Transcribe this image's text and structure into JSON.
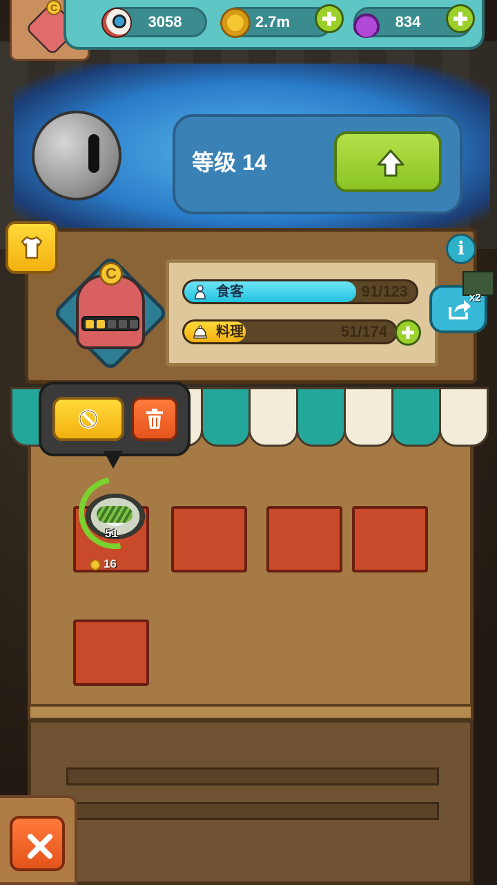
{
  "resources": {
    "eyeballs": "3058",
    "coins": "2.7m",
    "potions": "834"
  },
  "level": {
    "label": "等级 14"
  },
  "stats": {
    "guests_label": "食客",
    "guests_value": "91/123",
    "guests_fill": 0.74,
    "dishes_label": "料理",
    "dishes_value": "51/174",
    "dishes_fill": 0.29
  },
  "share": {
    "multiplier": "x2"
  },
  "dish_slot": {
    "count": "51",
    "price": "16",
    "progress": 0.75
  },
  "colors": {
    "accent_green": "#9bd02a",
    "accent_yellow": "#f2b10f",
    "accent_orange": "#e4541c",
    "guests_bar": "#22c2df",
    "awning_teal": "#23a79b"
  },
  "icons": {
    "eyeball": "eyeball-icon",
    "coin": "coin-icon",
    "potion": "potion-icon",
    "plus": "plus-icon",
    "level_up": "arrow-up-icon",
    "shirt": "shirt-icon",
    "info": "info-icon",
    "share": "share-icon",
    "guest": "person-icon",
    "dish": "cloche-icon",
    "cancel": "no-symbol-icon",
    "delete": "trash-icon",
    "close": "close-icon"
  }
}
